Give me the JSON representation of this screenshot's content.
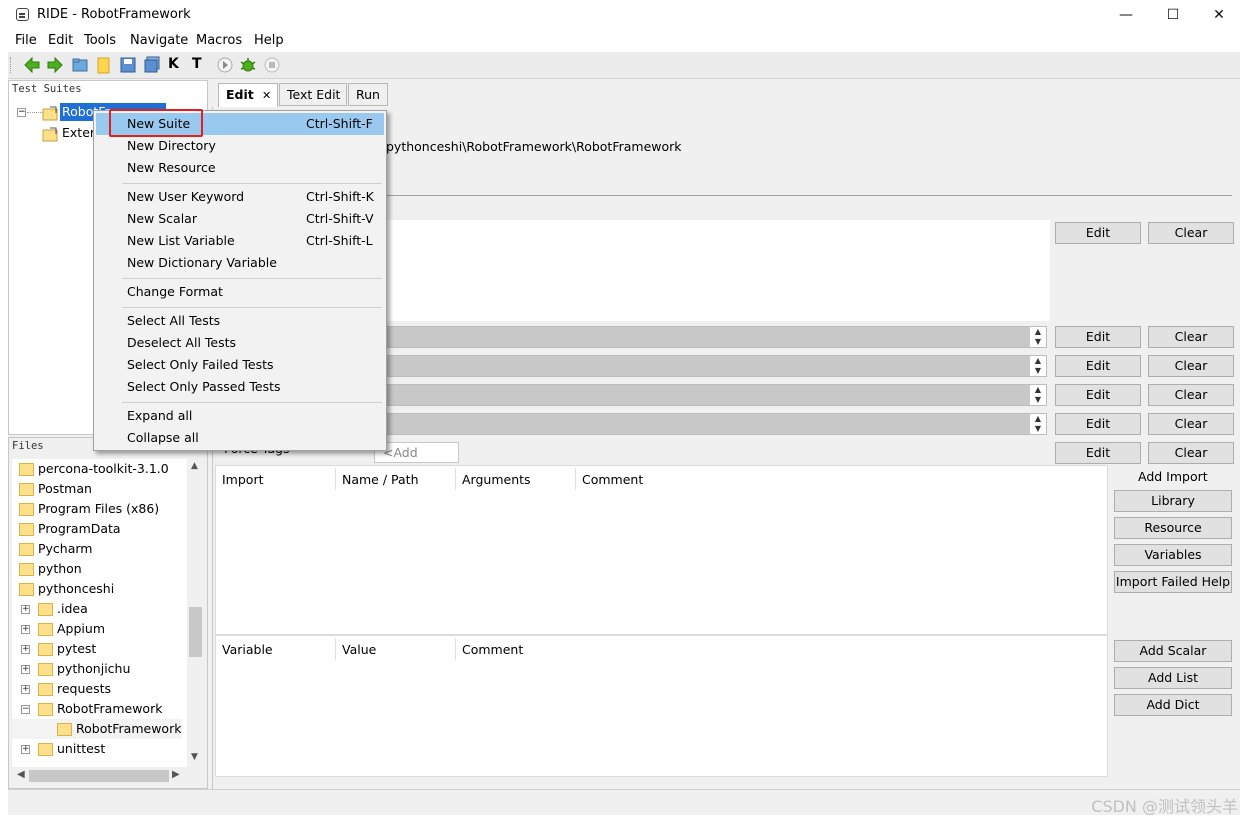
{
  "window": {
    "title": "RIDE - RobotFramework",
    "minimize": "—",
    "maximize": "☐",
    "close": "✕"
  },
  "menubar": [
    "File",
    "Edit",
    "Tools",
    "Navigate",
    "Macros",
    "Help"
  ],
  "toolbar": {
    "icons": [
      "back-arrow-icon",
      "forward-arrow-icon",
      "open-folder-icon",
      "folder-icon",
      "save-icon",
      "save-all-icon",
      "search-keyword-icon",
      "search-test-icon",
      "run-icon",
      "debug-icon",
      "stop-icon"
    ],
    "k_label": "K",
    "t_label": "T"
  },
  "test_suites": {
    "title": "Test Suites",
    "root_item": "RobotFr",
    "second_item": "Exter"
  },
  "files": {
    "title": "Files",
    "items": [
      "percona-toolkit-3.1.0",
      "Postman",
      "Program Files (x86)",
      "ProgramData",
      "Pycharm",
      "python",
      "pythonceshi",
      ".idea",
      "Appium",
      "pytest",
      "pythonjichu",
      "requests",
      "RobotFramework",
      "RobotFramework",
      "unittest"
    ]
  },
  "tabs": [
    "Edit",
    "Text Edit",
    "Run"
  ],
  "tab_close": "✕",
  "editor": {
    "path": "pythonceshi\\RobotFramework\\RobotFramework",
    "edit_label": "Edit",
    "clear_label": "Clear",
    "force_tags": "Force Tags",
    "add_new": "<Add New>",
    "imports": {
      "headers": [
        "Import",
        "Name / Path",
        "Arguments",
        "Comment"
      ]
    },
    "variables": {
      "headers": [
        "Variable",
        "Value",
        "Comment"
      ]
    },
    "add_import": "Add Import",
    "import_buttons": [
      "Library",
      "Resource",
      "Variables",
      "Import Failed Help"
    ],
    "variable_buttons": [
      "Add Scalar",
      "Add List",
      "Add Dict"
    ]
  },
  "context_menu": {
    "items": [
      {
        "label": "New Suite",
        "shortcut": "Ctrl-Shift-F"
      },
      {
        "label": "New Directory",
        "shortcut": ""
      },
      {
        "label": "New Resource",
        "shortcut": ""
      },
      {
        "label": "New User Keyword",
        "shortcut": "Ctrl-Shift-K"
      },
      {
        "label": "New Scalar",
        "shortcut": "Ctrl-Shift-V"
      },
      {
        "label": "New List Variable",
        "shortcut": "Ctrl-Shift-L"
      },
      {
        "label": "New Dictionary Variable",
        "shortcut": ""
      },
      {
        "label": "Change Format",
        "shortcut": ""
      },
      {
        "label": "Select All Tests",
        "shortcut": ""
      },
      {
        "label": "Deselect All Tests",
        "shortcut": ""
      },
      {
        "label": "Select Only Failed Tests",
        "shortcut": ""
      },
      {
        "label": "Select Only Passed Tests",
        "shortcut": ""
      },
      {
        "label": "Expand all",
        "shortcut": ""
      },
      {
        "label": "Collapse all",
        "shortcut": ""
      }
    ],
    "highlight_color": "#99c9ef",
    "annotation_color": "#e0201c"
  },
  "watermark": "CSDN @测试领头羊"
}
